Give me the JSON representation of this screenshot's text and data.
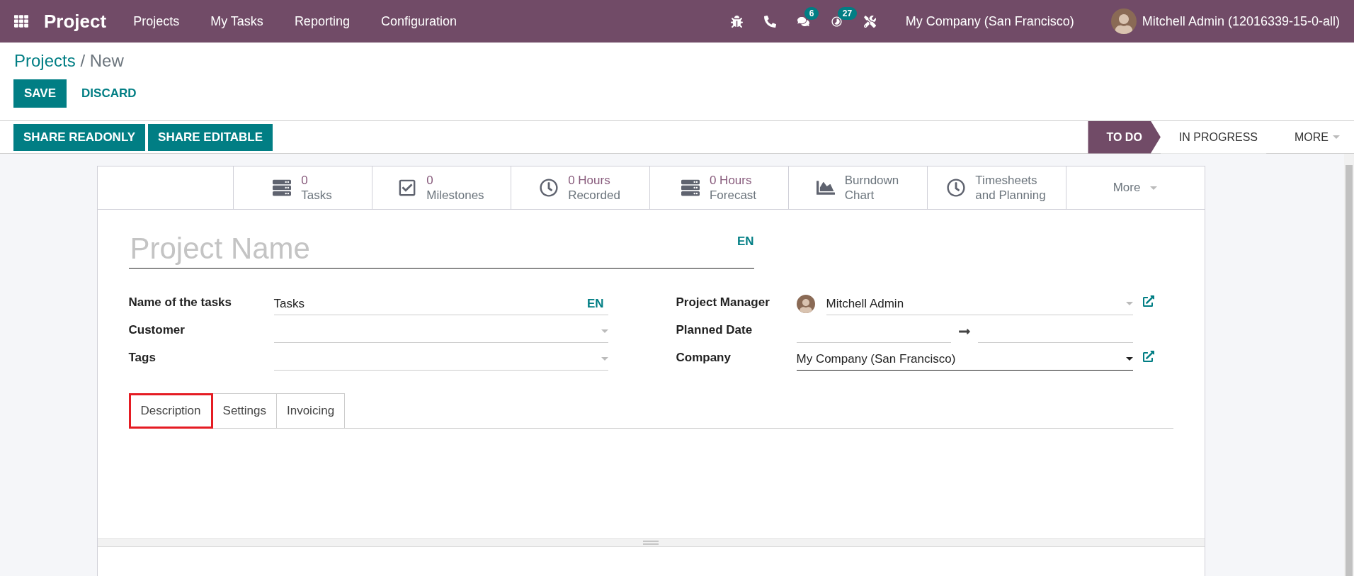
{
  "navbar": {
    "app_name": "Project",
    "menu": [
      "Projects",
      "My Tasks",
      "Reporting",
      "Configuration"
    ],
    "systray": [
      {
        "kind": "bug"
      },
      {
        "kind": "phone"
      },
      {
        "kind": "chat",
        "badge": "6"
      },
      {
        "kind": "activity",
        "badge": "27"
      },
      {
        "kind": "tools"
      }
    ],
    "company": "My Company (San Francisco)",
    "user": "Mitchell Admin (12016339-15-0-all)"
  },
  "breadcrumb": {
    "parent": "Projects",
    "separator": "/",
    "current": "New"
  },
  "buttons": [
    "SAVE",
    "DISCARD"
  ],
  "action_buttons": [
    "SHARE READONLY",
    "SHARE EDITABLE"
  ],
  "stages": [
    {
      "label": "TO DO",
      "selected": true
    },
    {
      "label": "IN PROGRESS",
      "selected": false
    }
  ],
  "stages_more": "MORE",
  "stat_buttons": [
    {
      "value": "0",
      "label": "Tasks"
    },
    {
      "value": "0",
      "label": "Milestones"
    },
    {
      "value": "0 Hours",
      "label": "Recorded"
    },
    {
      "value": "0 Hours",
      "label": "Forecast"
    },
    {
      "text": "Burndown",
      "label": "Chart"
    },
    {
      "text": "Timesheets",
      "label": "and Planning"
    }
  ],
  "stat_more": "More",
  "title": {
    "placeholder": "Project Name",
    "lang": "EN"
  },
  "fields_left": [
    {
      "label": "Name of the tasks",
      "kind": "translatable",
      "value": "Tasks",
      "lang": "EN",
      "focused": false,
      "external": false
    },
    {
      "label": "Customer",
      "kind": "select",
      "focused": false,
      "external": false
    },
    {
      "label": "Tags",
      "kind": "select",
      "focused": false,
      "external": false
    }
  ],
  "fields_right": [
    {
      "label": "Project Manager",
      "kind": "user",
      "value": "Mitchell Admin",
      "focused": false,
      "external": true
    },
    {
      "label": "Planned Date",
      "kind": "daterange",
      "focused": false,
      "external": false
    },
    {
      "label": "Company",
      "kind": "select",
      "value": "My Company (San Francisco)",
      "focused": true,
      "external": true
    }
  ],
  "tabs": [
    {
      "label": "Description",
      "selected": true
    },
    {
      "label": "Settings",
      "selected": false
    },
    {
      "label": "Invoicing",
      "selected": false
    }
  ]
}
